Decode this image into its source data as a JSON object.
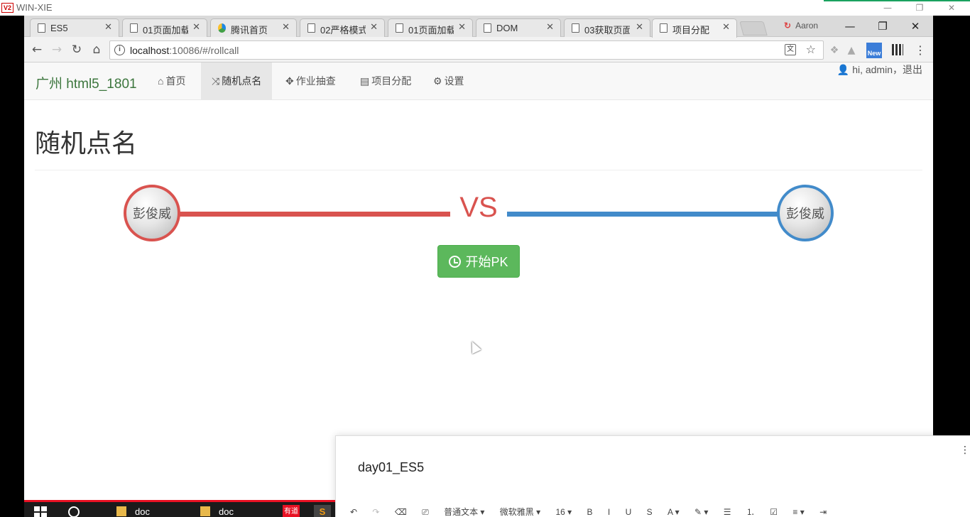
{
  "remote_desktop": {
    "logo": "V2",
    "host": "WIN-XIE",
    "controls": [
      "—",
      "❐",
      "✕"
    ]
  },
  "browser": {
    "tabs": [
      {
        "title": "ES5",
        "icon": "page-icon"
      },
      {
        "title": "01页面加载",
        "icon": "page-icon"
      },
      {
        "title": "腾讯首页",
        "icon": "tencent-icon"
      },
      {
        "title": "02严格模式",
        "icon": "page-icon"
      },
      {
        "title": "01页面加载",
        "icon": "page-icon"
      },
      {
        "title": "DOM",
        "icon": "page-icon"
      },
      {
        "title": "03获取页面",
        "icon": "page-icon"
      },
      {
        "title": "项目分配",
        "icon": "page-icon",
        "active": true
      }
    ],
    "profile_name": "Aaron",
    "window_controls": [
      "—",
      "❐",
      "✕"
    ],
    "url_host": "localhost",
    "url_path": ":10086/#/rollcall",
    "ext_new_label": "New"
  },
  "app": {
    "brand": "广州 html5_1801",
    "nav": [
      {
        "label": "首页",
        "icon": "home-icon",
        "glyph": "⌂"
      },
      {
        "label": "随机点名",
        "icon": "shuffle-icon",
        "glyph": "⤨",
        "active": true
      },
      {
        "label": "作业抽查",
        "icon": "move-icon",
        "glyph": "✥"
      },
      {
        "label": "项目分配",
        "icon": "list-icon",
        "glyph": "▤"
      },
      {
        "label": "设置",
        "icon": "gear-icon",
        "glyph": "⚙"
      }
    ],
    "user_text": "hi, admin，退出",
    "page_title": "随机点名",
    "player_left": "彭俊威",
    "player_right": "彭俊威",
    "vs": "VS",
    "start_button": "开始PK",
    "colors": {
      "red": "#d9534f",
      "blue": "#428bca",
      "green": "#5cb85c",
      "brand": "#3c763d"
    }
  },
  "note_panel": {
    "title": "day01_ES5",
    "toolbar": [
      "↶",
      "↷",
      "⌫",
      "⎚",
      "普通文本 ▾",
      "微软雅黑 ▾",
      "16 ▾",
      "B",
      "I",
      "U",
      "S",
      "A ▾",
      "✎ ▾",
      "☰",
      "⒈",
      "☑",
      "≡ ▾",
      "⇥"
    ]
  },
  "taskbar": {
    "items": [
      "doc",
      "doc"
    ],
    "youdao_label": "有道",
    "sublime_label": "S"
  }
}
